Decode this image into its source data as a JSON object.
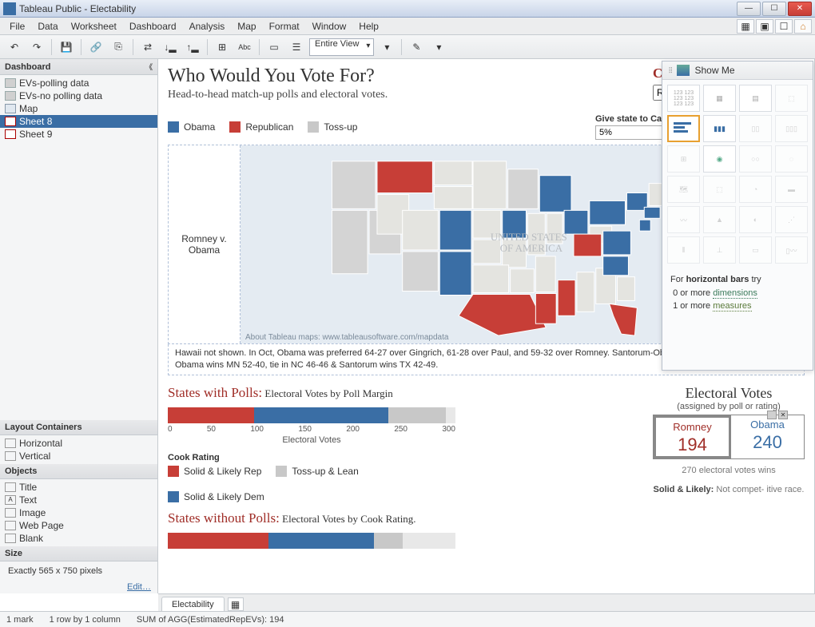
{
  "titlebar": {
    "app": "Tableau Public - Electability"
  },
  "menu": [
    "File",
    "Data",
    "Worksheet",
    "Dashboard",
    "Analysis",
    "Map",
    "Format",
    "Window",
    "Help"
  ],
  "toolbar": {
    "view_mode": "Entire View"
  },
  "sidebar": {
    "header": "Dashboard",
    "sheets": [
      {
        "label": "EVs-polling data",
        "icon": "worksheet"
      },
      {
        "label": "EVs-no polling data",
        "icon": "worksheet"
      },
      {
        "label": "Map",
        "icon": "map"
      },
      {
        "label": "Sheet 8",
        "icon": "sheet",
        "selected": true
      },
      {
        "label": "Sheet 9",
        "icon": "sheet"
      }
    ],
    "layout_header": "Layout Containers",
    "layout_items": [
      "Horizontal",
      "Vertical"
    ],
    "objects_header": "Objects",
    "object_items": [
      "Title",
      "Text",
      "Image",
      "Web Page",
      "Blank"
    ],
    "size_header": "Size",
    "size_text": "Exactly 565 x 750 pixels",
    "edit_link": "Edit…"
  },
  "dashboard": {
    "title": "Who Would You Vote For?",
    "subtitle": "Head-to-head match-up polls and electoral votes.",
    "choose_label": "Choose Candidate",
    "choose_value": "Romney",
    "legend": [
      {
        "key": "obama",
        "label": "Obama"
      },
      {
        "key": "rep",
        "label": "Republican"
      },
      {
        "key": "toss",
        "label": "Toss-up"
      }
    ],
    "give_label": "Give state to Candidate if they poll ahead by:",
    "give_value": "5%",
    "map_label": "Romney v. Obama",
    "map_attrib": "About Tableau maps: www.tableausoftware.com/mapdata",
    "caption": "Hawaii not shown.   In Oct, Obama was preferred 64-27 over Gingrich, 61-28 over Paul, and 59-32 over Romney. Santorum-Obama available for three states. Obama wins MN 52-40, tie in NC 46-46 & Santorum wins TX 42-49.",
    "states_with_polls_title": "States with Polls:",
    "states_with_polls_sub": "Electoral Votes by Poll Margin",
    "states_without_polls_title": "States without Polls:",
    "states_without_polls_sub": "Electoral Votes by Cook Rating.",
    "bar_axis": [
      "0",
      "50",
      "100",
      "150",
      "200",
      "250",
      "300"
    ],
    "bar_xlabel": "Electoral Votes",
    "cook_title": "Cook Rating",
    "cook_legend": [
      {
        "key": "red",
        "label": "Solid & Likely Rep"
      },
      {
        "key": "gray",
        "label": "Toss-up & Lean"
      },
      {
        "key": "blue",
        "label": "Solid & Likely Dem"
      }
    ],
    "ev_title": "Electoral Votes",
    "ev_sub": "(assigned by poll or rating)",
    "ev_candidates": [
      {
        "name": "Romney",
        "votes": "194",
        "cls": "rom"
      },
      {
        "name": "Obama",
        "votes": "240",
        "cls": "oba"
      }
    ],
    "ev_note": "270 electoral votes wins",
    "solid_note_b": "Solid & Likely:",
    "solid_note": " Not compet- itive race."
  },
  "chart_data": {
    "type": "bar",
    "title": "States with Polls: Electoral Votes by Poll Margin",
    "xlabel": "Electoral Votes",
    "xlim": [
      0,
      300
    ],
    "series": [
      {
        "name": "Republican",
        "value": 90,
        "color": "#c73e37"
      },
      {
        "name": "Obama",
        "value": 140,
        "color": "#3a6ea5"
      },
      {
        "name": "Toss-up",
        "value": 60,
        "color": "#c8c8c8"
      }
    ],
    "secondary": {
      "title": "States without Polls: Electoral Votes by Cook Rating",
      "series": [
        {
          "name": "Solid & Likely Rep",
          "value": 105,
          "color": "#c73e37"
        },
        {
          "name": "Solid & Likely Dem",
          "value": 110,
          "color": "#3a6ea5"
        },
        {
          "name": "Toss-up & Lean",
          "value": 30,
          "color": "#c8c8c8"
        }
      ]
    },
    "totals": {
      "Romney": 194,
      "Obama": 240,
      "needed_to_win": 270
    }
  },
  "showme": {
    "title": "Show Me",
    "hint_line1": "For ",
    "hint_bold": "horizontal bars",
    "hint_line1b": " try",
    "hint_line2a": "0 or more ",
    "hint_dim": "dimensions",
    "hint_line3a": "1 or more ",
    "hint_meas": "measures"
  },
  "tabs": {
    "active": "Electability"
  },
  "statusbar": {
    "marks": "1 mark",
    "rows": "1 row by 1 column",
    "sum": "SUM of AGG(EstimatedRepEVs): 194"
  }
}
